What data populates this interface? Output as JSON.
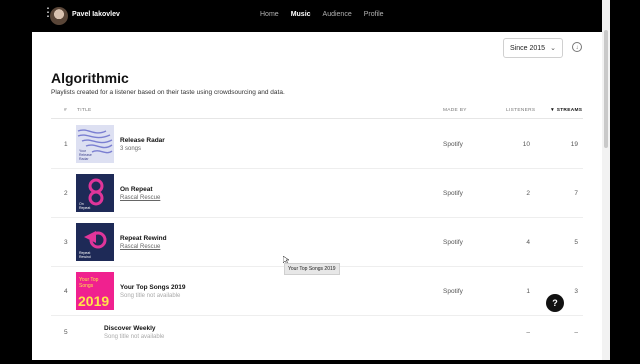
{
  "header": {
    "username": "Pavel Iakovlev",
    "nav": [
      "Home",
      "Music",
      "Audience",
      "Profile"
    ],
    "active_nav": "Music"
  },
  "filters": {
    "since": "Since 2015"
  },
  "section": {
    "title": "Algorithmic",
    "subtitle": "Playlists created for a listener based on their taste using crowdsourcing and data."
  },
  "table": {
    "columns": {
      "num": "#",
      "title": "TITLE",
      "made_by": "MADE BY",
      "listeners": "LISTENERS",
      "streams": "STREAMS"
    },
    "sort_indicator": "▼",
    "rows": [
      {
        "num": "1",
        "title": "Release Radar",
        "subtitle": "3 songs",
        "made_by": "Spotify",
        "listeners": "10",
        "streams": "19",
        "art_text": "Your\nRelease\nRadar"
      },
      {
        "num": "2",
        "title": "On Repeat",
        "subtitle": "Rascal Rescue",
        "made_by": "Spotify",
        "listeners": "2",
        "streams": "7",
        "art_text": "On\nRepeat"
      },
      {
        "num": "3",
        "title": "Repeat Rewind",
        "subtitle": "Rascal Rescue",
        "made_by": "Spotify",
        "listeners": "4",
        "streams": "5",
        "art_text": "Repeat\nRewind"
      },
      {
        "num": "4",
        "title": "Your Top Songs 2019",
        "subtitle": "Song title not available",
        "made_by": "Spotify",
        "listeners": "1",
        "streams": "3",
        "art_text": "Your Top\nSongs",
        "art_year": "2019"
      },
      {
        "num": "5",
        "title": "Discover Weekly",
        "subtitle": "Song title not available",
        "made_by": "",
        "listeners": "–",
        "streams": "–"
      }
    ]
  },
  "tooltip": "Your Top Songs 2019",
  "help": "?"
}
